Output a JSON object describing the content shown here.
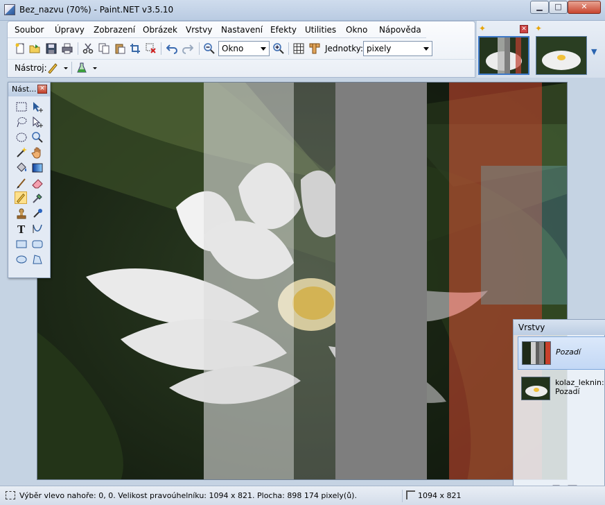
{
  "window": {
    "title": "Bez_nazvu (70%) - Paint.NET v3.5.10",
    "minimize_label": "▁",
    "maximize_label": "□",
    "close_label": "✕"
  },
  "menu": [
    {
      "label": "Soubor"
    },
    {
      "label": "Úpravy"
    },
    {
      "label": "Zobrazení"
    },
    {
      "label": "Obrázek"
    },
    {
      "label": "Vrstvy"
    },
    {
      "label": "Nastavení"
    },
    {
      "label": "Efekty"
    },
    {
      "label": "Utilities"
    },
    {
      "label": "Okno"
    },
    {
      "label": "Nápověda"
    }
  ],
  "toolbar": {
    "zoom_value": "Okno",
    "units_label": "Jednotky:",
    "units_value": "pixely",
    "tool_label": "Nástroj:"
  },
  "tools_window": {
    "title": "Nást...",
    "close_label": "✕",
    "selected_tool": "pencil-tool"
  },
  "layers_window": {
    "title": "Vrstvy",
    "layers": [
      {
        "name": "Pozadí",
        "selected": true
      },
      {
        "name_line1": "kolaz_leknin:",
        "name_line2": "Pozadí",
        "selected": false
      }
    ]
  },
  "status": {
    "selection_text": "Výběr vlevo nahoře: 0, 0. Velikost pravoúhelníku: 1094 x 821. Plocha: 898 174 pixely(ů).",
    "image_size": "1094 x 821"
  },
  "colors": {
    "accent": "#3c78c8",
    "selected_tool_bg": "#fde08b",
    "selected_layer_bg": "#c3d8f5",
    "canvas_bg": "#1e2a18"
  }
}
